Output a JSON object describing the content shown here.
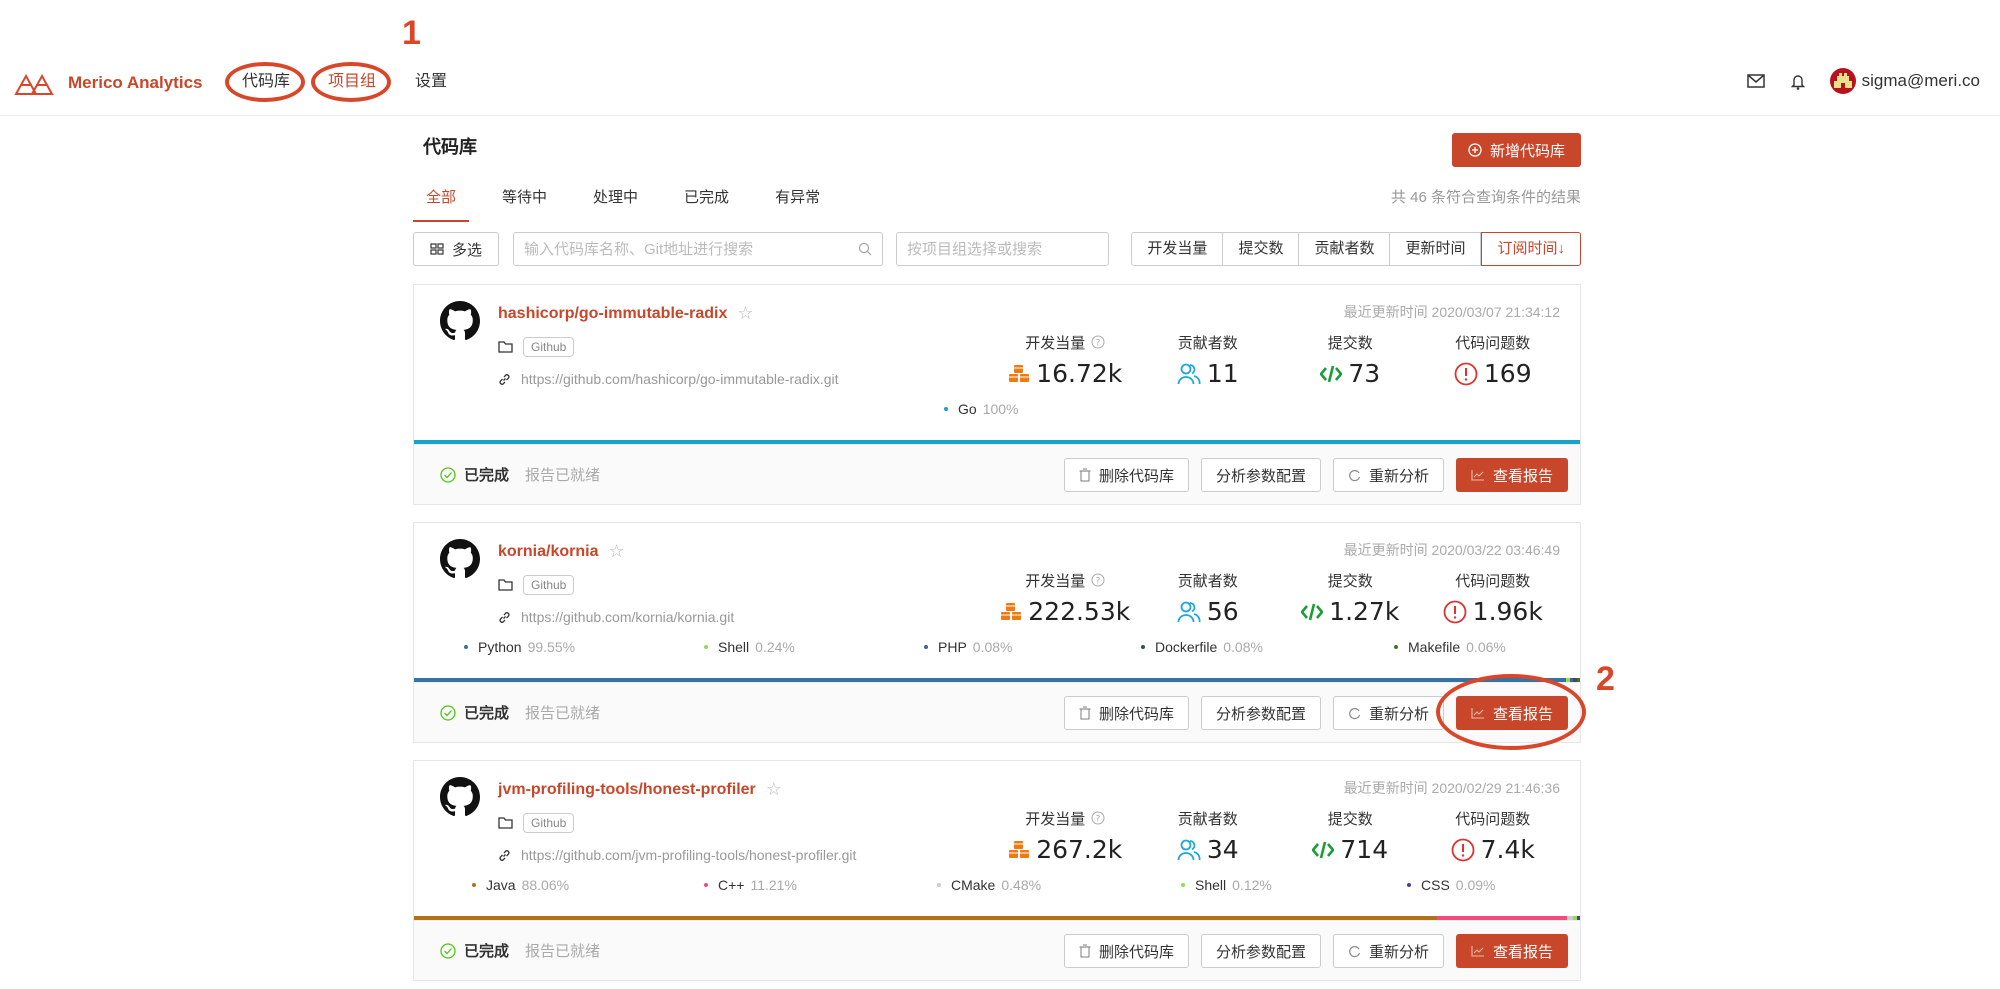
{
  "app": {
    "name": "Merico Analytics",
    "brand_color": "#c8472a"
  },
  "nav": {
    "items": [
      {
        "label": "代码库",
        "active": false
      },
      {
        "label": "项目组",
        "active": true
      },
      {
        "label": "设置",
        "active": false
      }
    ]
  },
  "user": {
    "email": "sigma@meri.co"
  },
  "annotations": [
    "1",
    "2"
  ],
  "page": {
    "title": "代码库",
    "add_button": "新增代码库",
    "result_count": "共 46 条符合查询条件的结果",
    "tabs": [
      "全部",
      "等待中",
      "处理中",
      "已完成",
      "有异常"
    ],
    "multi_select": "多选",
    "search_placeholder": "输入代码库名称、Git地址进行搜索",
    "group_placeholder": "按项目组选择或搜索",
    "sort_options": [
      "开发当量",
      "提交数",
      "贡献者数",
      "更新时间",
      "订阅时间↓"
    ]
  },
  "metric_labels": {
    "dev_eq": "开发当量",
    "contributors": "贡献者数",
    "commits": "提交数",
    "issues": "代码问题数"
  },
  "actions": {
    "delete": "删除代码库",
    "config": "分析参数配置",
    "reanalyze": "重新分析",
    "report": "查看报告"
  },
  "repos": [
    {
      "name": "hashicorp/go-immutable-radix",
      "source": "Github",
      "url": "https://github.com/hashicorp/go-immutable-radix.git",
      "updated": "最近更新时间 2020/03/07 21:34:12",
      "dev_eq": "16.72k",
      "contributors": "11",
      "commits": "73",
      "issues": "169",
      "status": "已完成",
      "status_sub": "报告已就绪",
      "languages": [
        {
          "name": "Go",
          "pct": "100%",
          "value": 100,
          "color": "#17a2c8"
        }
      ]
    },
    {
      "name": "kornia/kornia",
      "source": "Github",
      "url": "https://github.com/kornia/kornia.git",
      "updated": "最近更新时间 2020/03/22 03:46:49",
      "dev_eq": "222.53k",
      "contributors": "56",
      "commits": "1.27k",
      "issues": "1.96k",
      "status": "已完成",
      "status_sub": "报告已就绪",
      "languages": [
        {
          "name": "Python",
          "pct": "99.55%",
          "value": 99.55,
          "color": "#3572a5"
        },
        {
          "name": "Shell",
          "pct": "0.24%",
          "value": 0.24,
          "color": "#89e051"
        },
        {
          "name": "PHP",
          "pct": "0.08%",
          "value": 0.08,
          "color": "#4f5d95"
        },
        {
          "name": "Dockerfile",
          "pct": "0.08%",
          "value": 0.08,
          "color": "#384d54"
        },
        {
          "name": "Makefile",
          "pct": "0.06%",
          "value": 0.06,
          "color": "#427819"
        }
      ]
    },
    {
      "name": "jvm-profiling-tools/honest-profiler",
      "source": "Github",
      "url": "https://github.com/jvm-profiling-tools/honest-profiler.git",
      "updated": "最近更新时间 2020/02/29 21:46:36",
      "dev_eq": "267.2k",
      "contributors": "34",
      "commits": "714",
      "issues": "7.4k",
      "status": "已完成",
      "status_sub": "报告已就绪",
      "languages": [
        {
          "name": "Java",
          "pct": "88.06%",
          "value": 88.06,
          "color": "#b07219"
        },
        {
          "name": "C++",
          "pct": "11.21%",
          "value": 11.21,
          "color": "#f34b7d"
        },
        {
          "name": "CMake",
          "pct": "0.48%",
          "value": 0.48,
          "color": "#cccccc"
        },
        {
          "name": "Shell",
          "pct": "0.12%",
          "value": 0.12,
          "color": "#89e051"
        },
        {
          "name": "CSS",
          "pct": "0.09%",
          "value": 0.09,
          "color": "#563d7c"
        }
      ]
    }
  ]
}
